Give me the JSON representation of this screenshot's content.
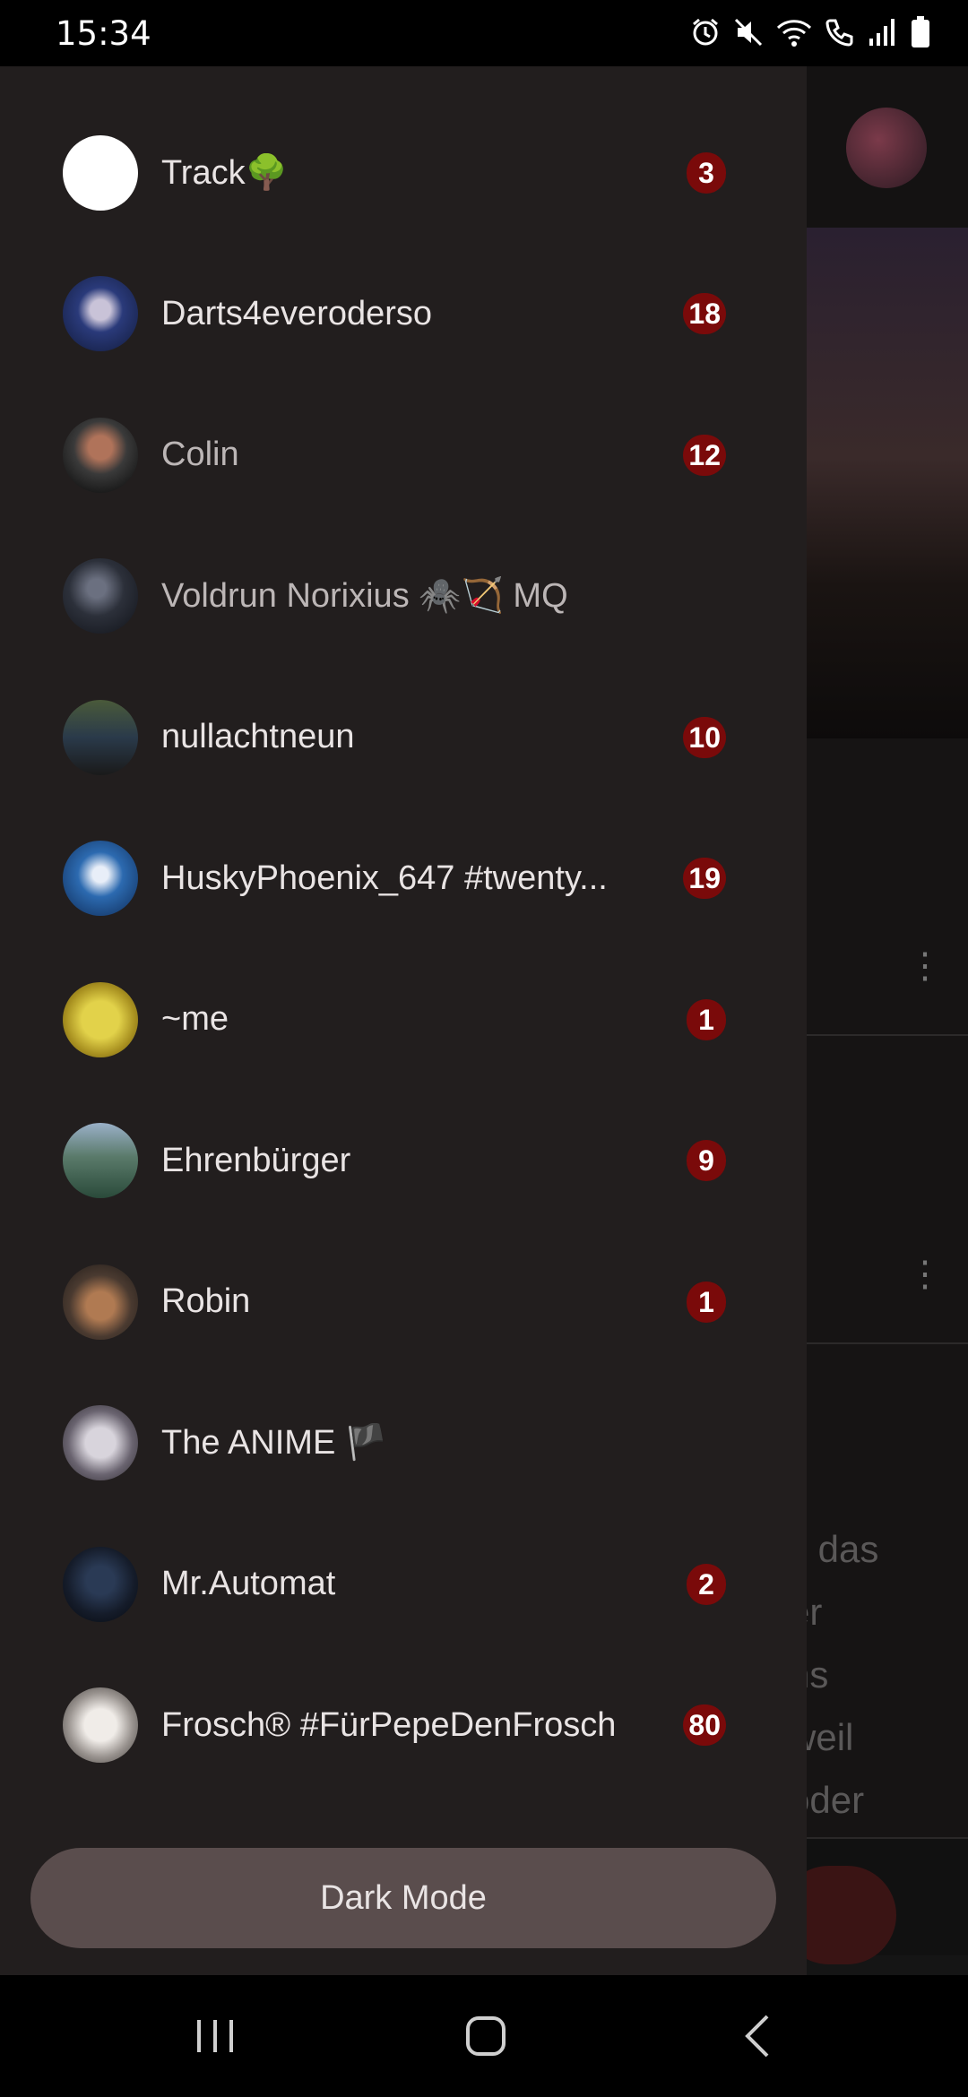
{
  "status_bar": {
    "time": "15:34",
    "icons": [
      "alarm-icon",
      "mute-icon",
      "wifi-icon",
      "wifi-call-icon",
      "signal-icon",
      "battery-icon"
    ]
  },
  "background_app": {
    "text_lines": [
      "s das",
      "er",
      "ns",
      "weil",
      "oder"
    ]
  },
  "chats": [
    {
      "name": "Track🌳",
      "badge": "3",
      "muted": false,
      "avatar": "white"
    },
    {
      "name": "Darts4everoderso",
      "badge": "18",
      "muted": false,
      "avatar": "darts"
    },
    {
      "name": "Colin",
      "badge": "12",
      "muted": true,
      "avatar": "colin"
    },
    {
      "name": "Voldrun Norixius 🕷️🏹 MQ",
      "badge": "",
      "muted": true,
      "avatar": "knight"
    },
    {
      "name": "nullachtneun",
      "badge": "10",
      "muted": false,
      "avatar": "tram"
    },
    {
      "name": "HuskyPhoenix_647 #twenty...",
      "badge": "19",
      "muted": false,
      "avatar": "husky"
    },
    {
      "name": "~me",
      "badge": "1",
      "muted": false,
      "avatar": "frog"
    },
    {
      "name": "Ehrenbürger",
      "badge": "9",
      "muted": false,
      "avatar": "lake"
    },
    {
      "name": "Robin",
      "badge": "1",
      "muted": false,
      "avatar": "robin"
    },
    {
      "name": "The ANIME 🏴",
      "badge": "",
      "muted": false,
      "avatar": "anime"
    },
    {
      "name": "Mr.Automat",
      "badge": "2",
      "muted": false,
      "avatar": "hood"
    },
    {
      "name": "Frosch® #FürPepeDenFrosch",
      "badge": "80",
      "muted": false,
      "avatar": "frosch"
    }
  ],
  "dark_mode_button": {
    "label": "Dark Mode"
  },
  "colors": {
    "drawer_bg": "#221e1e",
    "badge_bg": "#7a0a0a",
    "button_bg": "#5a4d4d"
  }
}
